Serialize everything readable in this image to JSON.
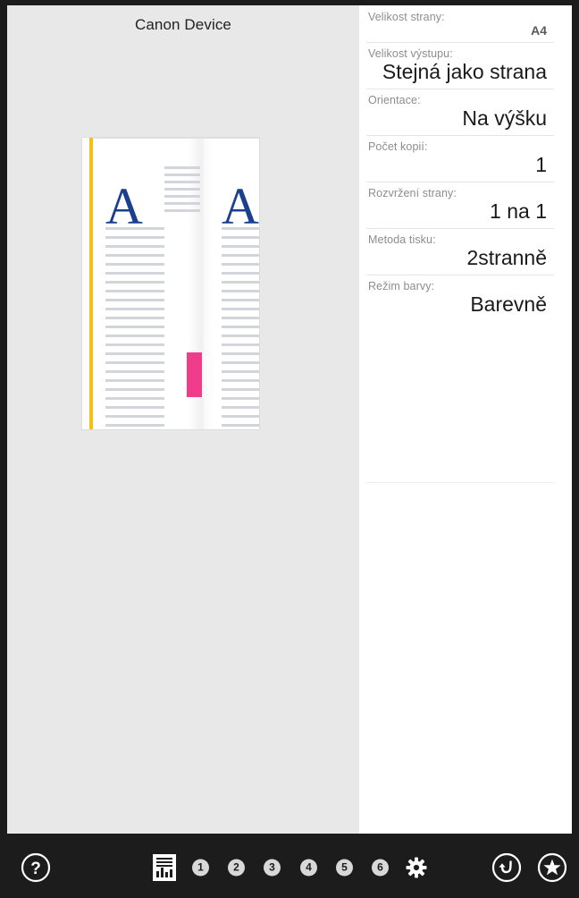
{
  "window": {
    "device_title": "Canon Device"
  },
  "preview": {
    "glyph_left": "A",
    "glyph_right": "A",
    "accent_edge_color": "#f3c018",
    "highlight_block_color": "#ef3d8c",
    "glyph_color": "#1b3f8f"
  },
  "settings": [
    {
      "label": "Velikost strany:",
      "value": "A4",
      "style": "small-bold"
    },
    {
      "label": "Velikost výstupu:",
      "value": "Stejná jako strana",
      "style": "normal"
    },
    {
      "label": "Orientace:",
      "value": "Na výšku",
      "style": "normal"
    },
    {
      "label": "Počet kopií:",
      "value": "1",
      "style": "normal"
    },
    {
      "label": "Rozvržení strany:",
      "value": "1 na 1",
      "style": "normal"
    },
    {
      "label": "Metoda tisku:",
      "value": "2stranně",
      "style": "normal"
    },
    {
      "label": "Režim barvy:",
      "value": "Barevně",
      "style": "normal"
    }
  ],
  "toolbar": {
    "background_color": "#1c1c1c",
    "help": {
      "icon": "help-circle-icon",
      "glyph": "?"
    },
    "report": {
      "icon": "report-document-icon"
    },
    "steps": [
      {
        "icon": "circled-number-icon",
        "label": "1"
      },
      {
        "icon": "circled-number-icon",
        "label": "2"
      },
      {
        "icon": "circled-number-icon",
        "label": "3"
      },
      {
        "icon": "circled-number-icon",
        "label": "4"
      },
      {
        "icon": "circled-number-icon",
        "label": "5"
      },
      {
        "icon": "circled-number-icon",
        "label": "6"
      }
    ],
    "settings_gear": {
      "icon": "gear-icon"
    },
    "reset": {
      "icon": "undo-reset-circle-icon"
    },
    "favorite": {
      "icon": "star-circle-icon"
    }
  }
}
